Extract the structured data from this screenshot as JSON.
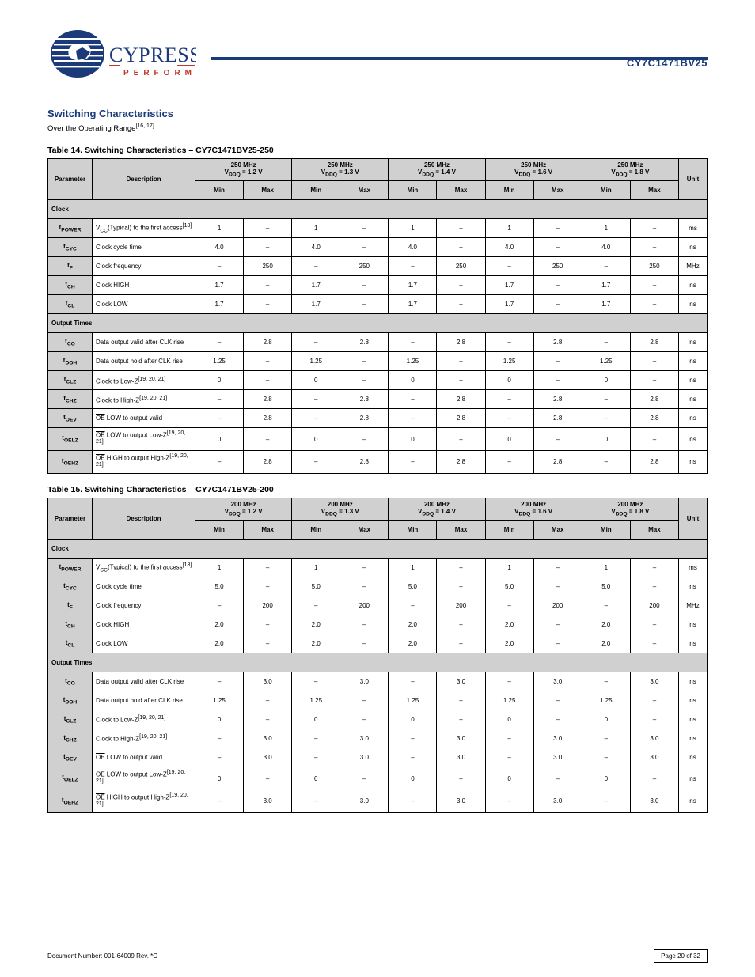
{
  "header": {
    "part_no": "CY7C1471BV25"
  },
  "section": {
    "title": "Switching Characteristics",
    "desc_prefix": "Over the Operating Range",
    "note_ref": "[16, 17]"
  },
  "table1": {
    "title": "Table 14. Switching Characteristics – CY7C1471BV25-250",
    "variants": [
      {
        "p": "250 MHz",
        "v": "1.2 V"
      },
      {
        "p": "250 MHz",
        "v": "1.3 V"
      },
      {
        "p": "250 MHz",
        "v": "1.4 V"
      },
      {
        "p": "250 MHz",
        "v": "1.6 V"
      },
      {
        "p": "250 MHz",
        "v": "1.8 V"
      }
    ]
  },
  "table2": {
    "title": "Table 15. Switching Characteristics – CY7C1471BV25-200",
    "variants": [
      {
        "p": "200 MHz",
        "v": "1.2 V"
      },
      {
        "p": "200 MHz",
        "v": "1.3 V"
      },
      {
        "p": "200 MHz",
        "v": "1.4 V"
      },
      {
        "p": "200 MHz",
        "v": "1.6 V"
      },
      {
        "p": "200 MHz",
        "v": "1.8 V"
      }
    ]
  },
  "rows_common": {
    "headers": [
      "Parameter",
      "Description",
      "Min",
      "Max",
      "Min",
      "Max",
      "Min",
      "Max",
      "Min",
      "Max",
      "Min",
      "Max",
      "Unit"
    ],
    "groups": [
      {
        "label": "Clock",
        "rows": [
          {
            "p": "t_POWER",
            "d": "V_CC(Typical) to the first access",
            "note": "[18]",
            "vals": [
              "1",
              "–",
              "1",
              "–",
              "1",
              "–",
              "1",
              "–",
              "1",
              "–"
            ],
            "u": "ms"
          },
          {
            "p": "t_CYC",
            "d": "Clock cycle time",
            "vals_t1": [
              "4.0",
              "–",
              "4.0",
              "–",
              "4.0",
              "–",
              "4.0",
              "–",
              "4.0",
              "–"
            ],
            "vals_t2": [
              "5.0",
              "–",
              "5.0",
              "–",
              "5.0",
              "–",
              "5.0",
              "–",
              "5.0",
              "–"
            ],
            "u": "ns"
          },
          {
            "p": "t_F",
            "d": "Clock frequency",
            "vals_t1": [
              "–",
              "250",
              "–",
              "250",
              "–",
              "250",
              "–",
              "250",
              "–",
              "250"
            ],
            "vals_t2": [
              "–",
              "200",
              "–",
              "200",
              "–",
              "200",
              "–",
              "200",
              "–",
              "200"
            ],
            "u": "MHz"
          },
          {
            "p": "t_CH",
            "d": "Clock HIGH",
            "vals_t1": [
              "1.7",
              "–",
              "1.7",
              "–",
              "1.7",
              "–",
              "1.7",
              "–",
              "1.7",
              "–"
            ],
            "vals_t2": [
              "2.0",
              "–",
              "2.0",
              "–",
              "2.0",
              "–",
              "2.0",
              "–",
              "2.0",
              "–"
            ],
            "u": "ns"
          },
          {
            "p": "t_CL",
            "d": "Clock LOW",
            "vals_t1": [
              "1.7",
              "–",
              "1.7",
              "–",
              "1.7",
              "–",
              "1.7",
              "–",
              "1.7",
              "–"
            ],
            "vals_t2": [
              "2.0",
              "–",
              "2.0",
              "–",
              "2.0",
              "–",
              "2.0",
              "–",
              "2.0",
              "–"
            ],
            "u": "ns"
          }
        ]
      },
      {
        "label": "Output Times",
        "rows": [
          {
            "p": "t_CO",
            "d": "Data output valid after CLK rise",
            "vals_t1": [
              "–",
              "2.8",
              "–",
              "2.8",
              "–",
              "2.8",
              "–",
              "2.8",
              "–",
              "2.8"
            ],
            "vals_t2": [
              "–",
              "3.0",
              "–",
              "3.0",
              "–",
              "3.0",
              "–",
              "3.0",
              "–",
              "3.0"
            ],
            "u": "ns"
          },
          {
            "p": "t_DOH",
            "d": "Data output hold after CLK rise",
            "vals": [
              "1.25",
              "–",
              "1.25",
              "–",
              "1.25",
              "–",
              "1.25",
              "–",
              "1.25",
              "–"
            ],
            "u": "ns"
          },
          {
            "p": "t_CLZ",
            "d": "Clock to Low-Z",
            "note": "[19, 20, 21]",
            "vals": [
              "0",
              "–",
              "0",
              "–",
              "0",
              "–",
              "0",
              "–",
              "0",
              "–"
            ],
            "u": "ns"
          },
          {
            "p": "t_CHZ",
            "d": "Clock to High-Z",
            "note": "[19, 20, 21]",
            "vals_t1": [
              "–",
              "2.8",
              "–",
              "2.8",
              "–",
              "2.8",
              "–",
              "2.8",
              "–",
              "2.8"
            ],
            "vals_t2": [
              "–",
              "3.0",
              "–",
              "3.0",
              "–",
              "3.0",
              "–",
              "3.0",
              "–",
              "3.0"
            ],
            "u": "ns"
          },
          {
            "p": "t_OEV",
            "d": "OE LOW to output valid",
            "vals_t1": [
              "–",
              "2.8",
              "–",
              "2.8",
              "–",
              "2.8",
              "–",
              "2.8",
              "–",
              "2.8"
            ],
            "vals_t2": [
              "–",
              "3.0",
              "–",
              "3.0",
              "–",
              "3.0",
              "–",
              "3.0",
              "–",
              "3.0"
            ],
            "u": "ns"
          },
          {
            "p": "t_OELZ",
            "d": "OE LOW to output Low-Z",
            "note": "[19, 20, 21]",
            "vals": [
              "0",
              "–",
              "0",
              "–",
              "0",
              "–",
              "0",
              "–",
              "0",
              "–"
            ],
            "u": "ns"
          },
          {
            "p": "t_OEHZ",
            "d": "OE HIGH to output High-Z",
            "note": "[19, 20, 21]",
            "vals_t1": [
              "–",
              "2.8",
              "–",
              "2.8",
              "–",
              "2.8",
              "–",
              "2.8",
              "–",
              "2.8"
            ],
            "vals_t2": [
              "–",
              "3.0",
              "–",
              "3.0",
              "–",
              "3.0",
              "–",
              "3.0",
              "–",
              "3.0"
            ],
            "u": "ns"
          }
        ]
      }
    ]
  },
  "footer": {
    "doc": "Document Number: 001-64009 Rev. *C",
    "page": "Page 20 of 32"
  }
}
